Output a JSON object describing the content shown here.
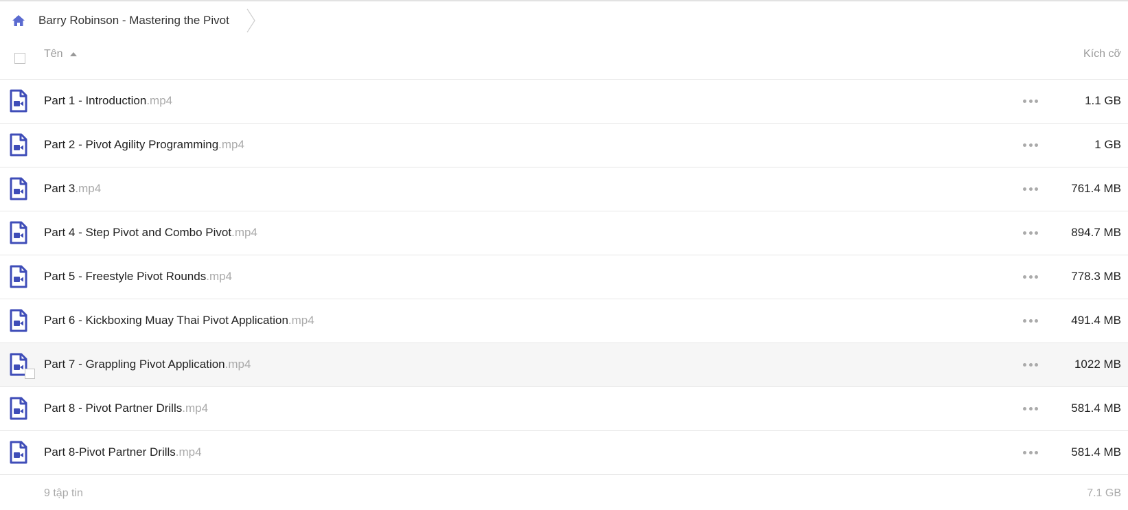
{
  "breadcrumb": {
    "home_icon": "home-icon",
    "folder_name": "Barry Robinson - Mastering the Pivot"
  },
  "columns": {
    "name": "Tên",
    "size": "Kích cỡ"
  },
  "colors": {
    "icon_accent": "#3f4db8",
    "muted_text": "#aaaaaa"
  },
  "files": [
    {
      "name": "Part 1 - Introduction",
      "ext": ".mp4",
      "size": "1.1 GB"
    },
    {
      "name": "Part 2 - Pivot Agility Programming",
      "ext": ".mp4",
      "size": "1 GB"
    },
    {
      "name": "Part 3",
      "ext": ".mp4",
      "size": "761.4 MB"
    },
    {
      "name": "Part 4 - Step Pivot and Combo Pivot",
      "ext": ".mp4",
      "size": "894.7 MB"
    },
    {
      "name": "Part 5 - Freestyle Pivot Rounds",
      "ext": ".mp4",
      "size": "778.3 MB"
    },
    {
      "name": "Part 6 - Kickboxing Muay Thai Pivot Application",
      "ext": ".mp4",
      "size": "491.4 MB"
    },
    {
      "name": "Part 7 - Grappling Pivot Application",
      "ext": ".mp4",
      "size": "1022 MB"
    },
    {
      "name": "Part 8 - Pivot Partner Drills",
      "ext": ".mp4",
      "size": "581.4 MB"
    },
    {
      "name": "Part 8-Pivot Partner Drills",
      "ext": ".mp4",
      "size": "581.4 MB"
    }
  ],
  "footer": {
    "count": "9 tập tin",
    "total": "7.1 GB"
  }
}
